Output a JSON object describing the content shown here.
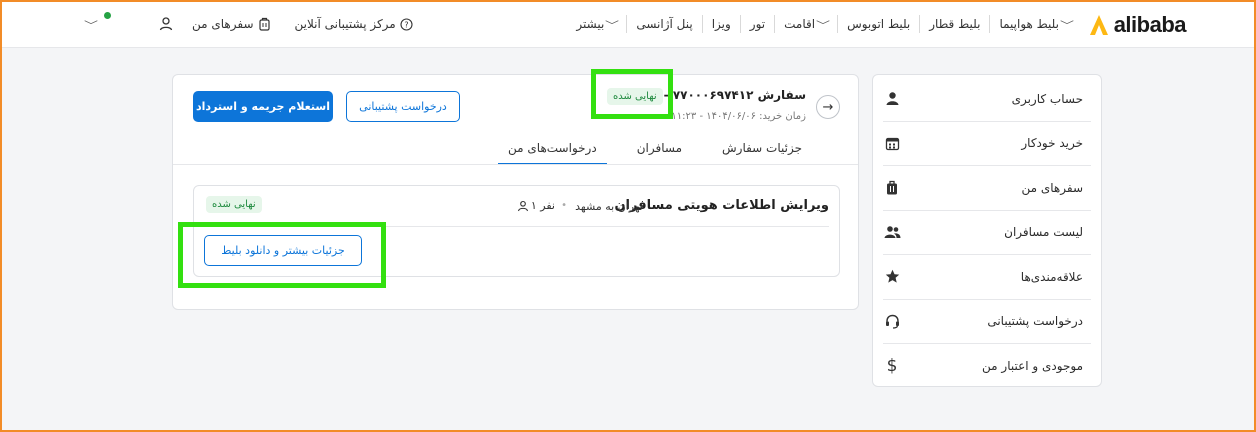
{
  "brand": {
    "name": "alibaba",
    "color": "#fdb813"
  },
  "nav": {
    "items": [
      {
        "label": "بلیط هواپیما",
        "has_dropdown": true
      },
      {
        "label": "بلیط قطار",
        "has_dropdown": false
      },
      {
        "label": "بلیط اتوبوس",
        "has_dropdown": false
      },
      {
        "label": "اقامت",
        "has_dropdown": true
      },
      {
        "label": "تور",
        "has_dropdown": false
      },
      {
        "label": "ویزا",
        "has_dropdown": false
      },
      {
        "label": "پنل آژانسی",
        "has_dropdown": false
      },
      {
        "label": "بیشتر",
        "has_dropdown": true
      }
    ],
    "support": "مرکز پشتیبانی آنلاین",
    "my_trips": "سفرهای من"
  },
  "sidebar": {
    "items": [
      {
        "label": "حساب کاربری",
        "icon": "user-icon"
      },
      {
        "label": "خرید خودکار",
        "icon": "calendar-icon"
      },
      {
        "label": "سفرهای من",
        "icon": "suitcase-icon"
      },
      {
        "label": "لیست مسافران",
        "icon": "users-icon"
      },
      {
        "label": "علاقه‌مندی‌ها",
        "icon": "star-icon"
      },
      {
        "label": "درخواست پشتیبانی",
        "icon": "headset-icon"
      },
      {
        "label": "موجودی و اعتبار من",
        "icon": "dollar-icon"
      }
    ]
  },
  "order": {
    "title": "سفارش ۷۷۰۰۰۶۹۷۴۱۲ - پرو",
    "status": "نهایی شده",
    "date": "زمان خرید: ۱۴۰۴/۰۶/۰۶ - ۱۱:۲۳",
    "primary_button": "استعلام جریمه و استرداد",
    "secondary_button": "درخواست پشتیبانی"
  },
  "tabs": [
    {
      "label": "جزئیات سفارش",
      "active": false
    },
    {
      "label": "مسافران",
      "active": false
    },
    {
      "label": "درخواست‌های من",
      "active": true
    }
  ],
  "request": {
    "title": "ویرایش اطلاعات هویتی مسافران",
    "route": "تهران به مشهد",
    "people": "۱ نفر",
    "status": "نهایی شده",
    "details_button": "جزئیات بیشتر و دانلود بلیط"
  },
  "colors": {
    "primary": "#0d75d9",
    "success_bg": "#e6f6ea",
    "success_text": "#1e8a3e",
    "highlight": "#33e010"
  }
}
